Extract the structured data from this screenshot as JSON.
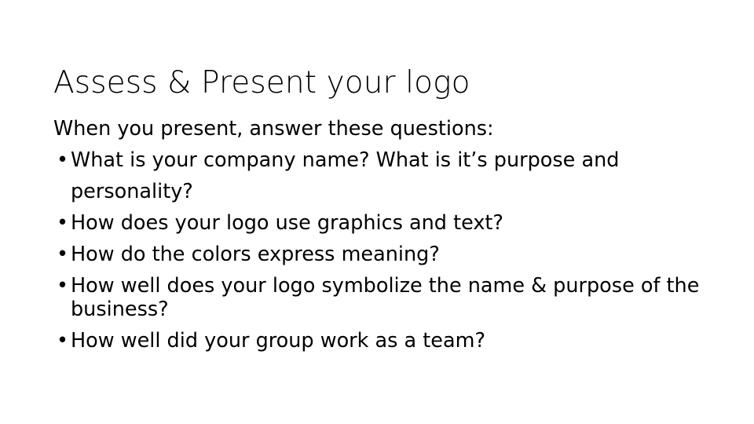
{
  "slide": {
    "title": "Assess & Present your logo",
    "lead": "When you present, answer these questions:",
    "bullet_marker": "•",
    "bullets": [
      "What is your company name? What is it’s purpose and personality?",
      "How does your logo use graphics and text?",
      "How do the colors express meaning?",
      "How well does your logo symbolize the name & purpose of the business?",
      "How well did your group work as a team?"
    ],
    "colors": {
      "background": "#ffffff",
      "text": "#000000"
    }
  }
}
